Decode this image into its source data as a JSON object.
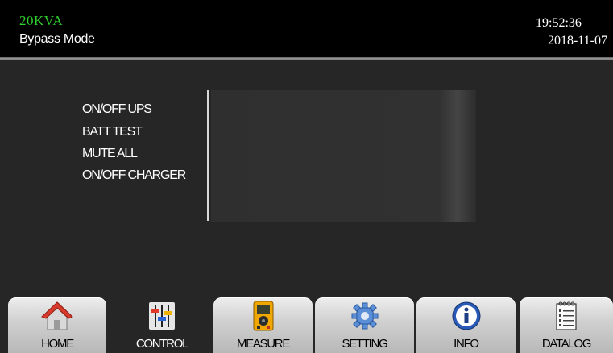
{
  "header": {
    "rating": "20KVA",
    "mode": "Bypass Mode",
    "time": "19:52:36",
    "date": "2018-11-07"
  },
  "control_menu": {
    "items": [
      {
        "label": "ON/OFF UPS"
      },
      {
        "label": "BATT TEST"
      },
      {
        "label": "MUTE ALL"
      },
      {
        "label": "ON/OFF CHARGER"
      }
    ]
  },
  "nav": {
    "active": "CONTROL",
    "tabs": [
      {
        "label": "HOME",
        "icon": "home-icon"
      },
      {
        "label": "CONTROL",
        "icon": "sliders-icon"
      },
      {
        "label": "MEASURE",
        "icon": "meter-icon"
      },
      {
        "label": "SETTING",
        "icon": "gear-icon"
      },
      {
        "label": "INFO",
        "icon": "info-icon"
      },
      {
        "label": "DATALOG",
        "icon": "notepad-icon"
      }
    ]
  },
  "colors": {
    "rating_text": "#2fd12f",
    "background": "#262626",
    "header_bg": "#000000",
    "tab_bg": "#d0d0d0"
  }
}
